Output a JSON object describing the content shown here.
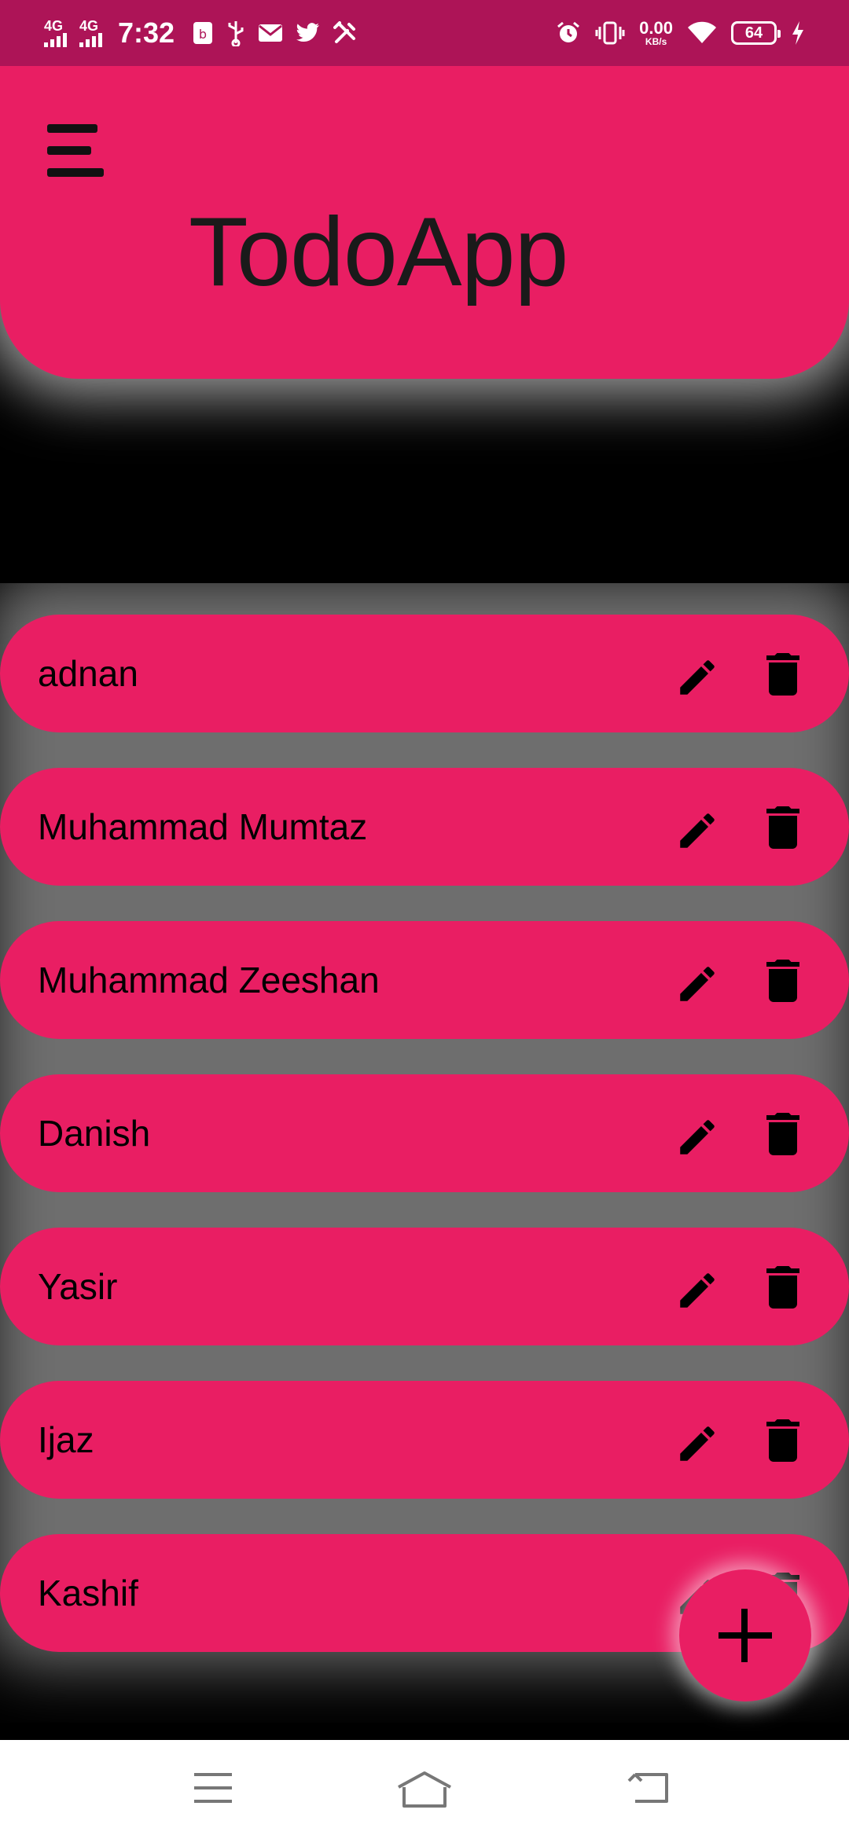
{
  "status_bar": {
    "network_1": "4G",
    "network_2": "4G",
    "time": "7:32",
    "speed_value": "0.00",
    "speed_unit": "KB/s",
    "battery": "64",
    "icons": [
      "signal-icon",
      "usb-debug-icon",
      "usb-icon",
      "mail-icon",
      "twitter-icon",
      "tools-icon",
      "alarm-icon",
      "vibrate-icon",
      "wifi-icon",
      "battery-icon",
      "charging-icon"
    ]
  },
  "header": {
    "menu_icon": "menu-icon",
    "title": "TodoApp"
  },
  "todos": [
    {
      "label": "adnan"
    },
    {
      "label": "Muhammad Mumtaz"
    },
    {
      "label": "Muhammad Zeeshan"
    },
    {
      "label": "Danish"
    },
    {
      "label": "Yasir"
    },
    {
      "label": "Ijaz"
    },
    {
      "label": "Kashif"
    }
  ],
  "row_icons": {
    "edit": "edit-icon",
    "delete": "delete-icon"
  },
  "fab": {
    "icon": "add-icon"
  },
  "nav_bar": {
    "icons": [
      "recent-apps-icon",
      "home-icon",
      "back-icon"
    ]
  },
  "colors": {
    "accent": "#e91e63",
    "status_bar": "#ad1457",
    "background": "#000000"
  }
}
